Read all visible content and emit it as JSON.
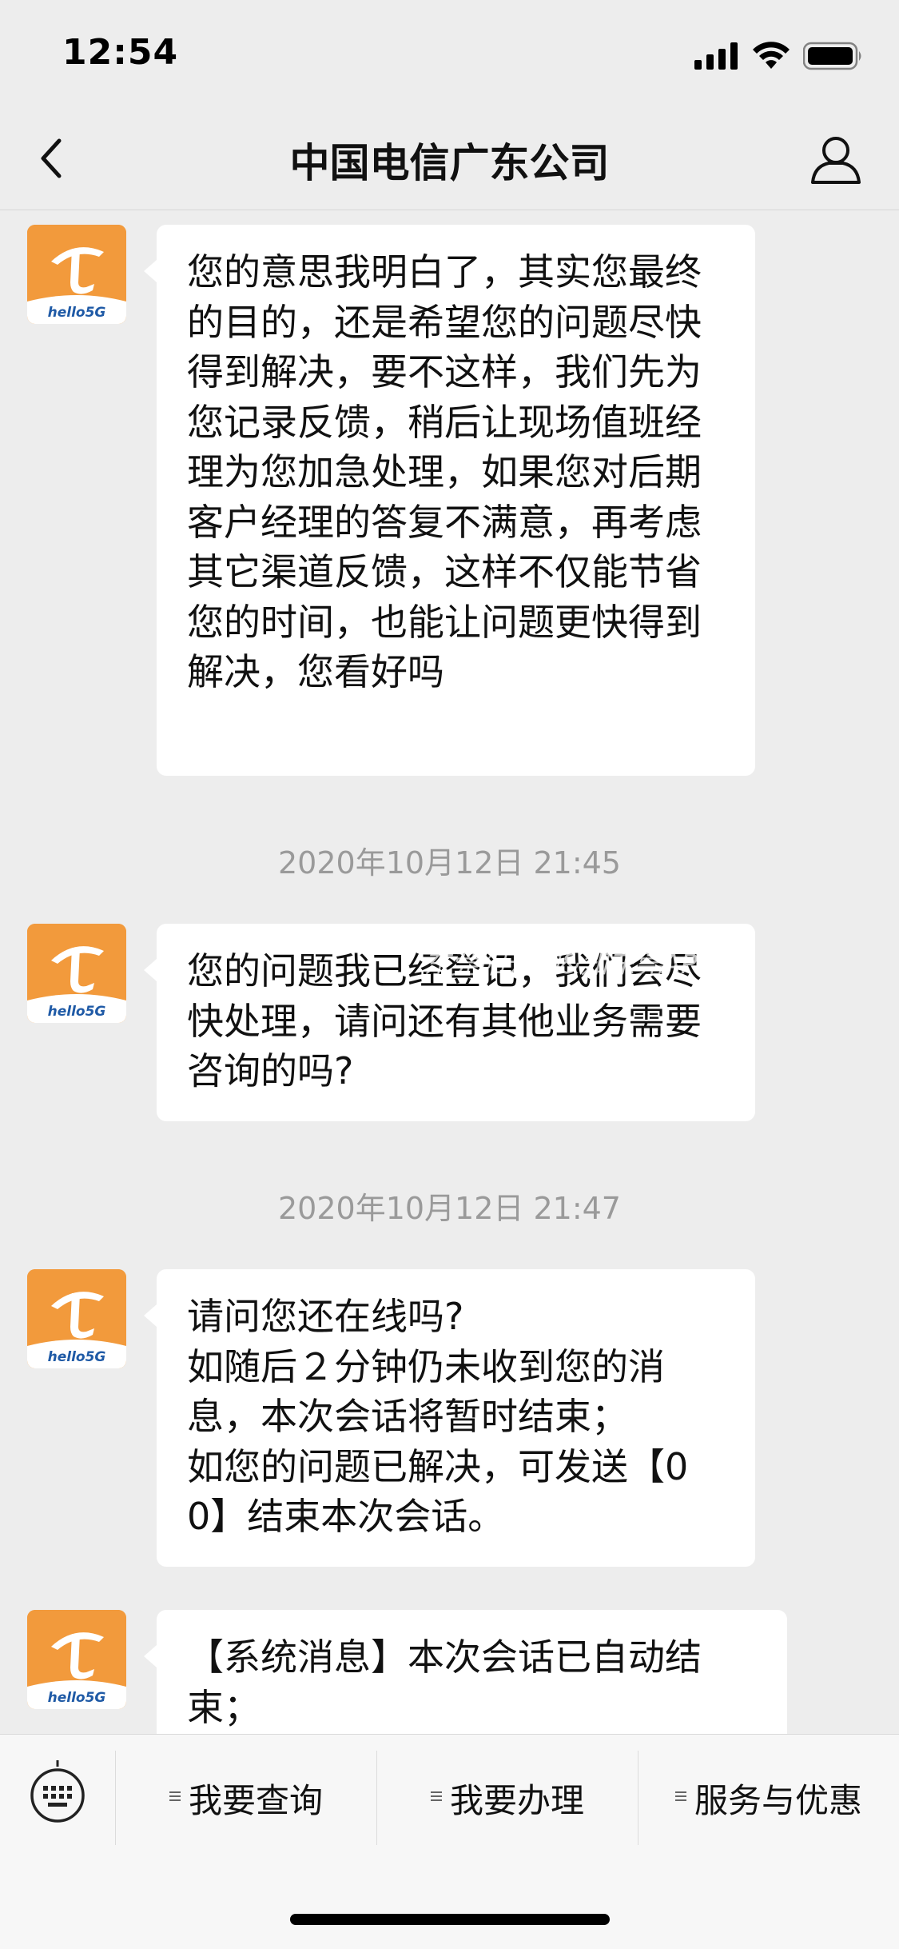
{
  "status_bar": {
    "time": "12:54"
  },
  "nav": {
    "title": "中国电信广东公司"
  },
  "avatar": {
    "brand_text": "hello5G",
    "color": "#f29a3c"
  },
  "messages": [
    {
      "text": "您的意思我明白了，其实您最终的目的，还是希望您的问题尽快得到解决，要不这样，我们先为您记录反馈，稍后让现场值班经理为您加急处理，如果您对后期客户经理的答复不满意，再考虑其它渠道反馈，这样不仅能节省您的时间，也能让问题更快得到解决，您看好吗"
    },
    {
      "timestamp": "2020年10月12日 21:45",
      "text": "您的问题我已经登记，我们会尽快处理，请问还有其他业务需要咨询的吗?"
    },
    {
      "timestamp": "2020年10月12日 21:47",
      "text": "请问您还在线吗?\n如随后２分钟仍未收到您的消息，本次会话将暂时结束；\n如您的问题已解决，可发送【00】结束本次会话。"
    },
    {
      "text": "【系统消息】本次会话已自动结束；"
    }
  ],
  "watermark": "东莞阳光网&知东莞APP",
  "bottom_menu": {
    "items": [
      {
        "label": "我要查询"
      },
      {
        "label": "我要办理"
      },
      {
        "label": "服务与优惠"
      }
    ]
  }
}
